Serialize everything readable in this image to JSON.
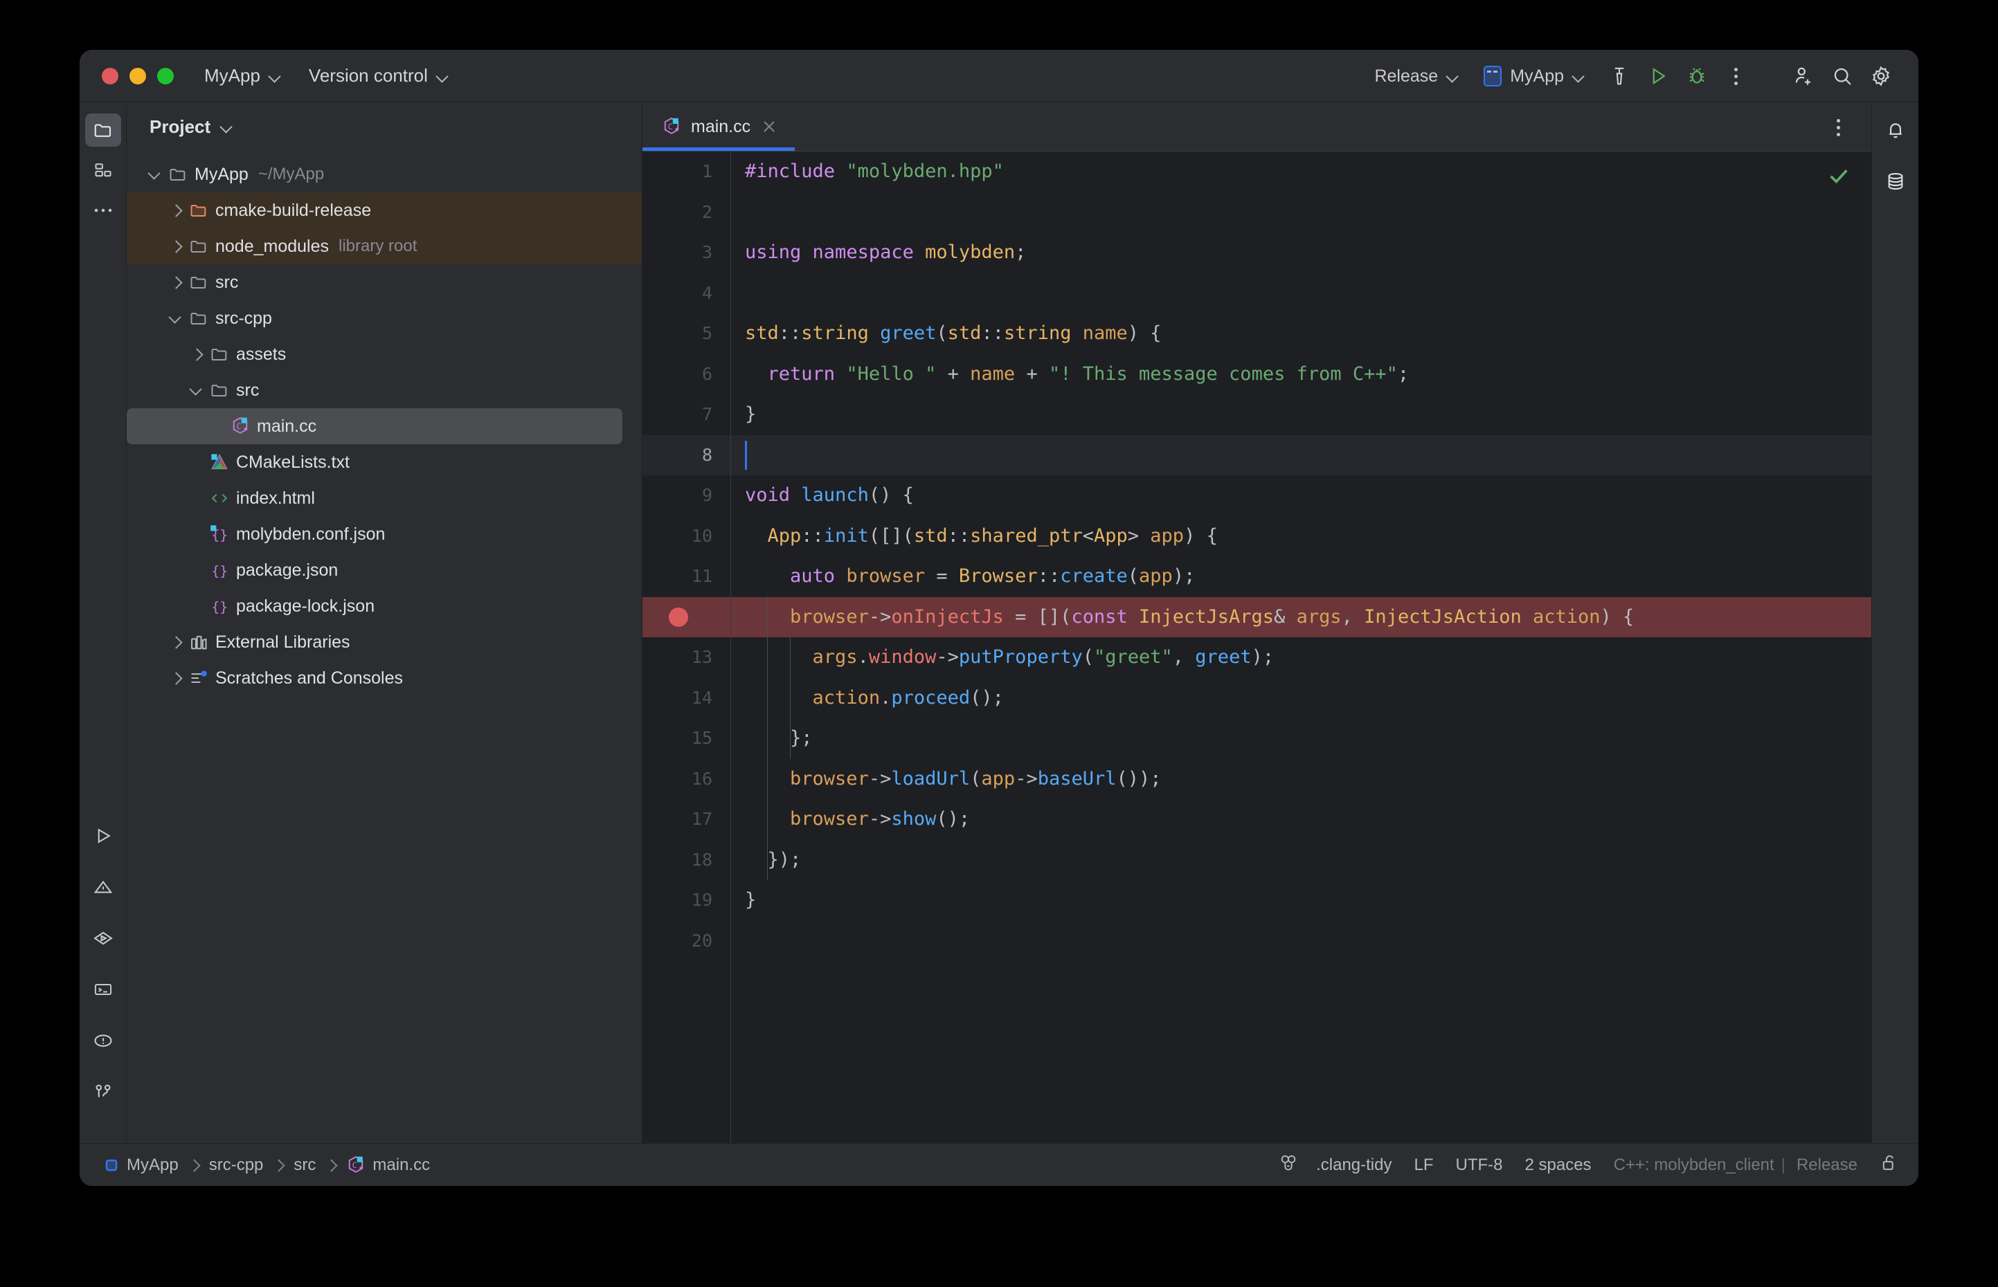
{
  "window": {
    "traffic_lights": [
      "close",
      "minimize",
      "maximize"
    ],
    "titlebar": {
      "project_menu": "MyApp",
      "vcs_menu": "Version control",
      "build_config": "Release",
      "run_config": "MyApp",
      "actions": [
        "build-icon",
        "run-icon",
        "debug-icon",
        "more-icon"
      ],
      "right_actions": [
        "add-user-icon",
        "search-icon",
        "settings-icon"
      ]
    }
  },
  "left_rail": {
    "top": [
      {
        "name": "project-tool-window",
        "icon": "folder-icon",
        "active": true
      },
      {
        "name": "structure-tool-window",
        "icon": "structure-icon",
        "active": false
      },
      {
        "name": "more-tool-windows",
        "icon": "ellipsis-icon",
        "active": false
      }
    ],
    "bottom": [
      {
        "name": "run-tool-window",
        "icon": "run-icon"
      },
      {
        "name": "problems-tool-window",
        "icon": "warning-triangle-icon"
      },
      {
        "name": "services-tool-window",
        "icon": "services-icon"
      },
      {
        "name": "terminal-tool-window",
        "icon": "terminal-icon"
      },
      {
        "name": "notifications-tool-window",
        "icon": "alert-circle-icon"
      },
      {
        "name": "version-control-tool-window",
        "icon": "git-branch-icon"
      }
    ]
  },
  "right_rail": [
    {
      "name": "notifications",
      "icon": "bell-icon"
    },
    {
      "name": "database",
      "icon": "database-icon"
    }
  ],
  "project_panel": {
    "title": "Project",
    "tree": [
      {
        "label": "MyApp",
        "hint": "~/MyApp",
        "depth": 0,
        "arrow": "down",
        "icon": "folder-icon",
        "state": "normal"
      },
      {
        "label": "cmake-build-release",
        "hint": "",
        "depth": 1,
        "arrow": "right",
        "icon": "folder-excluded-icon",
        "state": "excluded"
      },
      {
        "label": "node_modules",
        "hint": "library root",
        "depth": 1,
        "arrow": "right",
        "icon": "folder-icon",
        "state": "excluded"
      },
      {
        "label": "src",
        "hint": "",
        "depth": 1,
        "arrow": "right",
        "icon": "folder-icon",
        "state": "normal"
      },
      {
        "label": "src-cpp",
        "hint": "",
        "depth": 1,
        "arrow": "down",
        "icon": "folder-icon",
        "state": "normal"
      },
      {
        "label": "assets",
        "hint": "",
        "depth": 2,
        "arrow": "right",
        "icon": "folder-icon",
        "state": "normal"
      },
      {
        "label": "src",
        "hint": "",
        "depth": 2,
        "arrow": "down",
        "icon": "folder-icon",
        "state": "normal"
      },
      {
        "label": "main.cc",
        "hint": "",
        "depth": 3,
        "arrow": "none",
        "icon": "cpp-file-icon",
        "state": "selected"
      },
      {
        "label": "CMakeLists.txt",
        "hint": "",
        "depth": 2,
        "arrow": "none",
        "icon": "cmake-file-icon",
        "state": "normal"
      },
      {
        "label": "index.html",
        "hint": "",
        "depth": 2,
        "arrow": "none",
        "icon": "html-file-icon",
        "state": "normal"
      },
      {
        "label": "molybden.conf.json",
        "hint": "",
        "depth": 2,
        "arrow": "none",
        "icon": "json-config-icon",
        "state": "normal"
      },
      {
        "label": "package.json",
        "hint": "",
        "depth": 2,
        "arrow": "none",
        "icon": "json-file-icon",
        "state": "normal"
      },
      {
        "label": "package-lock.json",
        "hint": "",
        "depth": 2,
        "arrow": "none",
        "icon": "json-file-icon",
        "state": "normal"
      },
      {
        "label": "External Libraries",
        "hint": "",
        "depth": 1,
        "arrow": "right",
        "icon": "libraries-icon",
        "state": "normal"
      },
      {
        "label": "Scratches and Consoles",
        "hint": "",
        "depth": 1,
        "arrow": "right",
        "icon": "scratches-icon",
        "state": "normal"
      }
    ]
  },
  "editor": {
    "tab": {
      "label": "main.cc",
      "icon": "cpp-file-icon",
      "active": true
    },
    "inspection_status": "ok",
    "breakpoint_line": 12,
    "caret_line": 8,
    "total_lines": 20,
    "lines": [
      {
        "n": 1,
        "text": "#include \"molybden.hpp\""
      },
      {
        "n": 2,
        "text": ""
      },
      {
        "n": 3,
        "text": "using namespace molybden;"
      },
      {
        "n": 4,
        "text": ""
      },
      {
        "n": 5,
        "text": "std::string greet(std::string name) {"
      },
      {
        "n": 6,
        "text": "  return \"Hello \" + name + \"! This message comes from C++\";"
      },
      {
        "n": 7,
        "text": "}"
      },
      {
        "n": 8,
        "text": ""
      },
      {
        "n": 9,
        "text": "void launch() {"
      },
      {
        "n": 10,
        "text": "  App::init([](std::shared_ptr<App> app) {"
      },
      {
        "n": 11,
        "text": "    auto browser = Browser::create(app);"
      },
      {
        "n": 12,
        "text": "    browser->onInjectJs = [](const InjectJsArgs& args, InjectJsAction action) {"
      },
      {
        "n": 13,
        "text": "      args.window->putProperty(\"greet\", greet);"
      },
      {
        "n": 14,
        "text": "      action.proceed();"
      },
      {
        "n": 15,
        "text": "    };"
      },
      {
        "n": 16,
        "text": "    browser->loadUrl(app->baseUrl());"
      },
      {
        "n": 17,
        "text": "    browser->show();"
      },
      {
        "n": 18,
        "text": "  });"
      },
      {
        "n": 19,
        "text": "}"
      },
      {
        "n": 20,
        "text": ""
      }
    ]
  },
  "status_bar": {
    "breadcrumbs": [
      {
        "label": "MyApp",
        "icon": "module-icon"
      },
      {
        "label": "src-cpp",
        "icon": ""
      },
      {
        "label": "src",
        "icon": ""
      },
      {
        "label": "main.cc",
        "icon": "cpp-file-icon"
      }
    ],
    "right": {
      "inspections_icon": "inspections-icon",
      "clang_tidy": ".clang-tidy",
      "line_separator": "LF",
      "encoding": "UTF-8",
      "indent": "2 spaces",
      "toolchain": "C++: molybden_client",
      "separator": "|",
      "config": "Release",
      "lock_icon": "unlocked-icon"
    }
  },
  "colors": {
    "accent": "#3574f0",
    "breakpoint": "#db5c5c",
    "breakpoint_row": "#6a3639",
    "excluded_row": "#3b3024",
    "editor_bg": "#1e1f22",
    "panel_bg": "#2b2d30"
  }
}
